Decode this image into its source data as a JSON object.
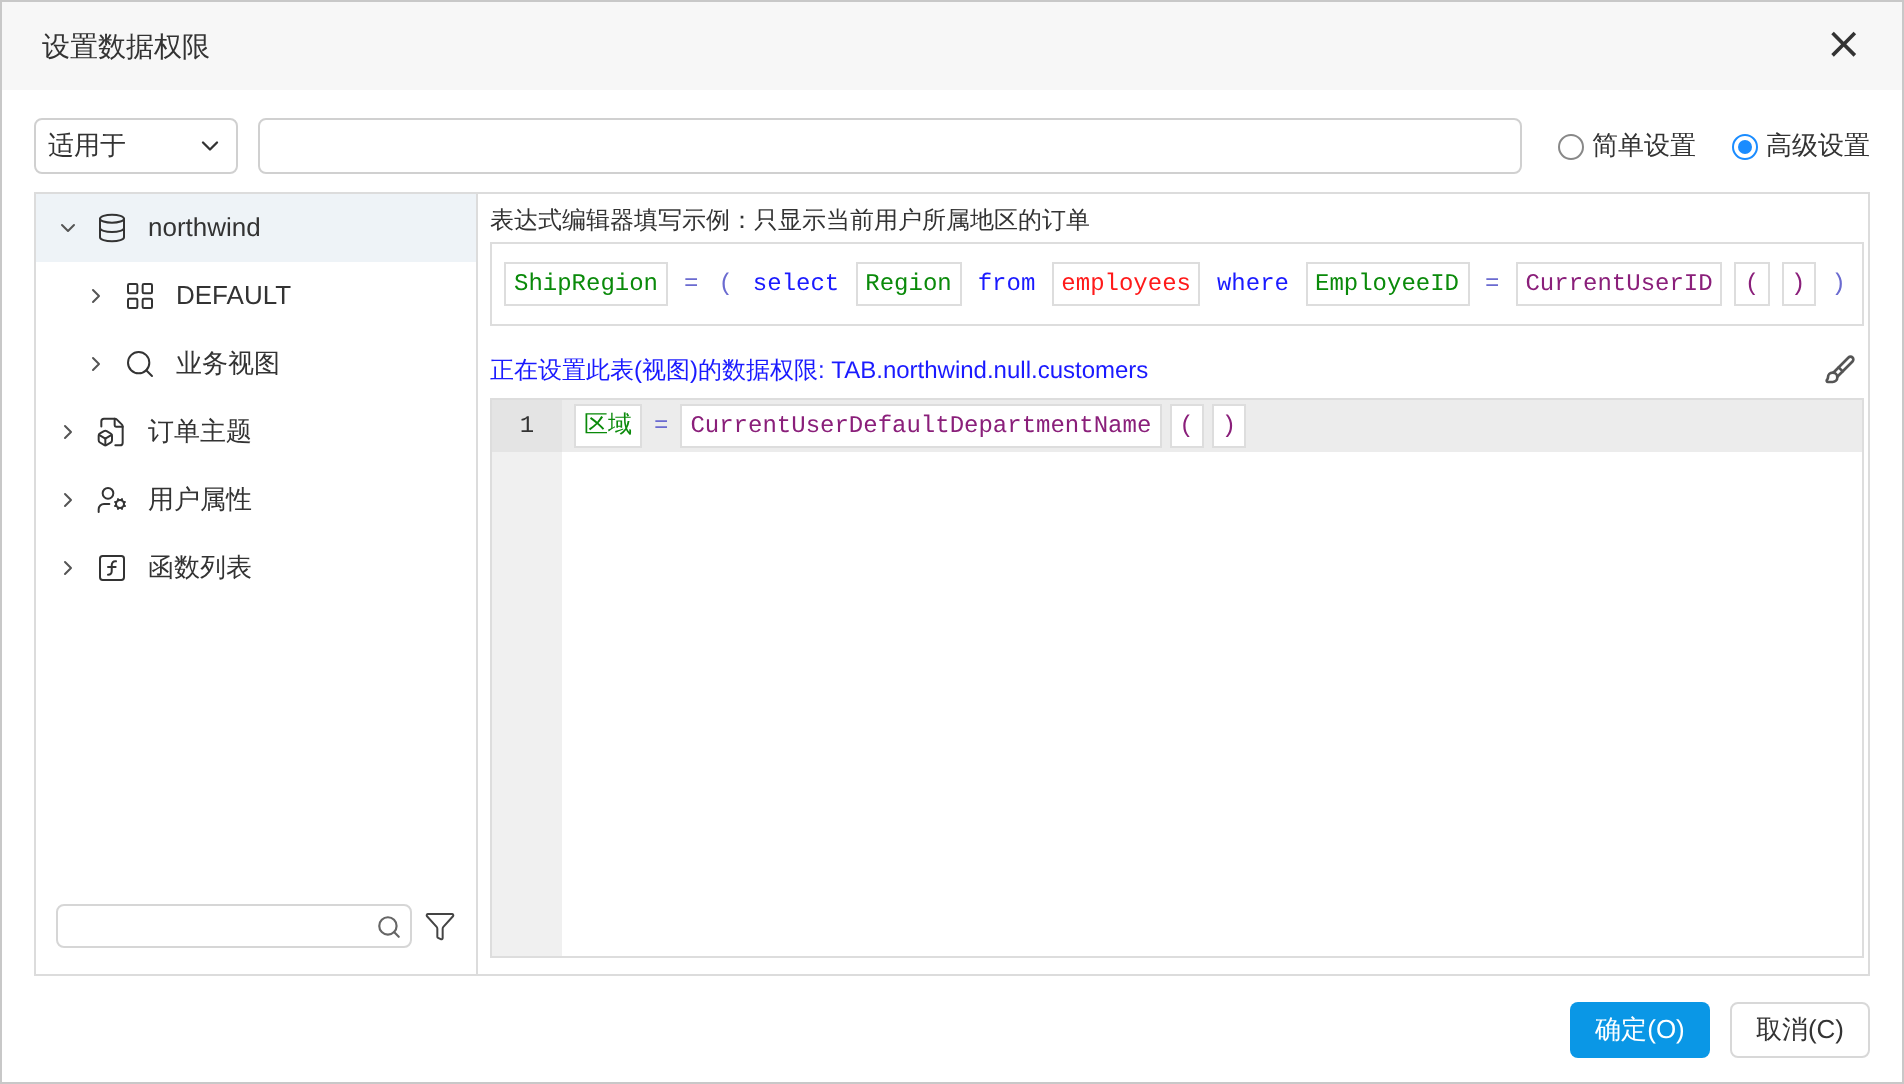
{
  "window": {
    "title": "设置数据权限",
    "close": "×"
  },
  "filter": {
    "scope": "适用于"
  },
  "modes": [
    {
      "label": "简单设置",
      "selected": false
    },
    {
      "label": "高级设置",
      "selected": true
    }
  ],
  "tree": [
    {
      "label": "northwind",
      "kind": "database",
      "expanded": true,
      "selected": true,
      "children": [
        {
          "label": "DEFAULT",
          "kind": "schema",
          "expanded": false,
          "selected": false
        },
        {
          "label": "业务视图",
          "kind": "view",
          "expanded": false,
          "selected": false
        }
      ]
    },
    {
      "label": "订单主题",
      "kind": "topic",
      "expanded": false,
      "selected": false
    },
    {
      "label": "用户属性",
      "kind": "attributes",
      "expanded": false,
      "selected": false
    },
    {
      "label": "函数列表",
      "kind": "functions",
      "expanded": false,
      "selected": false
    }
  ],
  "example": {
    "caption": "表达式编辑器填写示例：只显示当前用户所属地区的订单",
    "tokens": [
      {
        "text": "ShipRegion",
        "kind": "field"
      },
      {
        "text": "=",
        "kind": "operator"
      },
      {
        "text": "(",
        "kind": "operator"
      },
      {
        "text": "select",
        "kind": "keyword"
      },
      {
        "text": "Region",
        "kind": "field"
      },
      {
        "text": "from",
        "kind": "keyword"
      },
      {
        "text": "employees",
        "kind": "table"
      },
      {
        "text": "where",
        "kind": "keyword"
      },
      {
        "text": "EmployeeID",
        "kind": "field"
      },
      {
        "text": "=",
        "kind": "operator"
      },
      {
        "text": "CurrentUserID",
        "kind": "function"
      },
      {
        "text": "(",
        "kind": "paren"
      },
      {
        "text": ")",
        "kind": "paren"
      },
      {
        "text": ")",
        "kind": "operator"
      }
    ]
  },
  "target": "正在设置此表(视图)的数据权限: TAB.northwind.null.customers",
  "editor": {
    "lines": [
      {
        "number": "1",
        "tokens": [
          {
            "text": "区域",
            "kind": "field"
          },
          {
            "text": "=",
            "kind": "operator"
          },
          {
            "text": "CurrentUserDefaultDepartmentName",
            "kind": "function"
          },
          {
            "text": "(",
            "kind": "paren"
          },
          {
            "text": ")",
            "kind": "paren"
          }
        ]
      }
    ]
  },
  "buttons": [
    {
      "label": "确定(O)",
      "kind": "primary"
    },
    {
      "label": "取消(C)",
      "kind": "secondary"
    }
  ]
}
